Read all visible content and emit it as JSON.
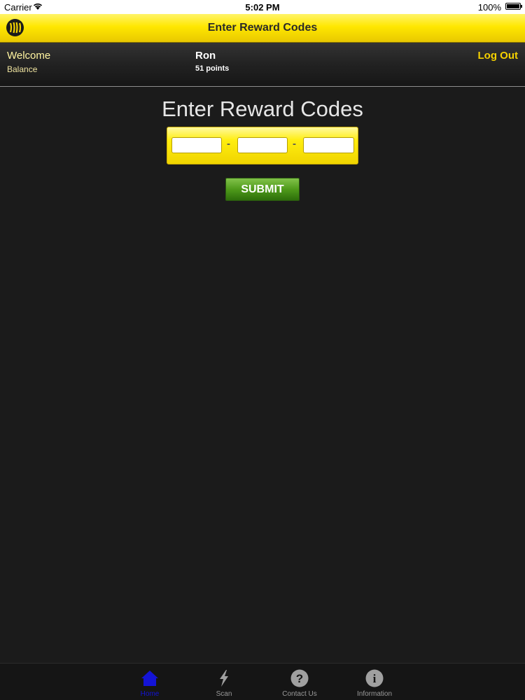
{
  "status_bar": {
    "carrier": "Carrier",
    "time": "5:02 PM",
    "battery": "100%"
  },
  "nav": {
    "title": "Enter Reward Codes",
    "logo_icon": "brand-logo-icon"
  },
  "header": {
    "welcome_label": "Welcome",
    "balance_label": "Balance",
    "user_name": "Ron",
    "points": "51 points",
    "logout_label": "Log Out"
  },
  "main": {
    "heading": "Enter Reward Codes",
    "code_fields": [
      {
        "value": "",
        "placeholder": ""
      },
      {
        "value": "",
        "placeholder": ""
      },
      {
        "value": "",
        "placeholder": ""
      }
    ],
    "separator": "-",
    "submit_label": "SUBMIT"
  },
  "tabs": [
    {
      "label": "Home",
      "icon": "home-icon",
      "active": true
    },
    {
      "label": "Scan",
      "icon": "lightning-icon",
      "active": false
    },
    {
      "label": "Contact Us",
      "icon": "question-icon",
      "active": false
    },
    {
      "label": "Information",
      "icon": "info-icon",
      "active": false
    }
  ],
  "colors": {
    "accent_yellow": "#ffe700",
    "submit_green": "#4e9a1a",
    "active_tab": "#1414d6",
    "background": "#1b1b1b"
  }
}
